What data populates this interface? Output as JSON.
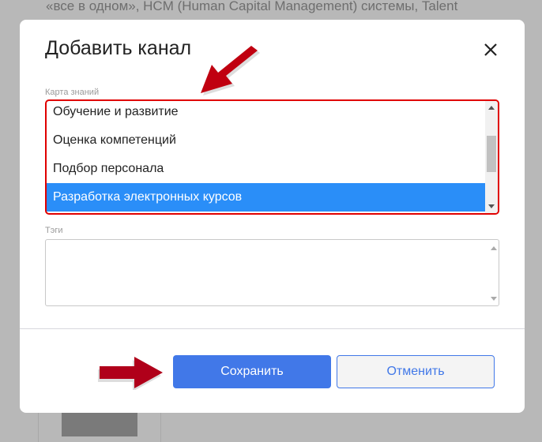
{
  "background": {
    "text": "«все в одном», HCM (Human Capital Management) системы, Talent"
  },
  "dialog": {
    "title": "Добавить канал",
    "knowledge_map": {
      "label": "Карта знаний",
      "options": [
        "Обучение и развитие",
        "Оценка компетенций",
        "Подбор персонала",
        "Разработка электронных курсов"
      ],
      "selected": "Разработка электронных курсов"
    },
    "tags": {
      "label": "Тэги",
      "value": ""
    },
    "save_label": "Сохранить",
    "cancel_label": "Отменить"
  },
  "colors": {
    "accent": "#4178e8",
    "selection": "#2a8ef8",
    "highlight": "#e00000",
    "arrow": "#b0001a"
  }
}
